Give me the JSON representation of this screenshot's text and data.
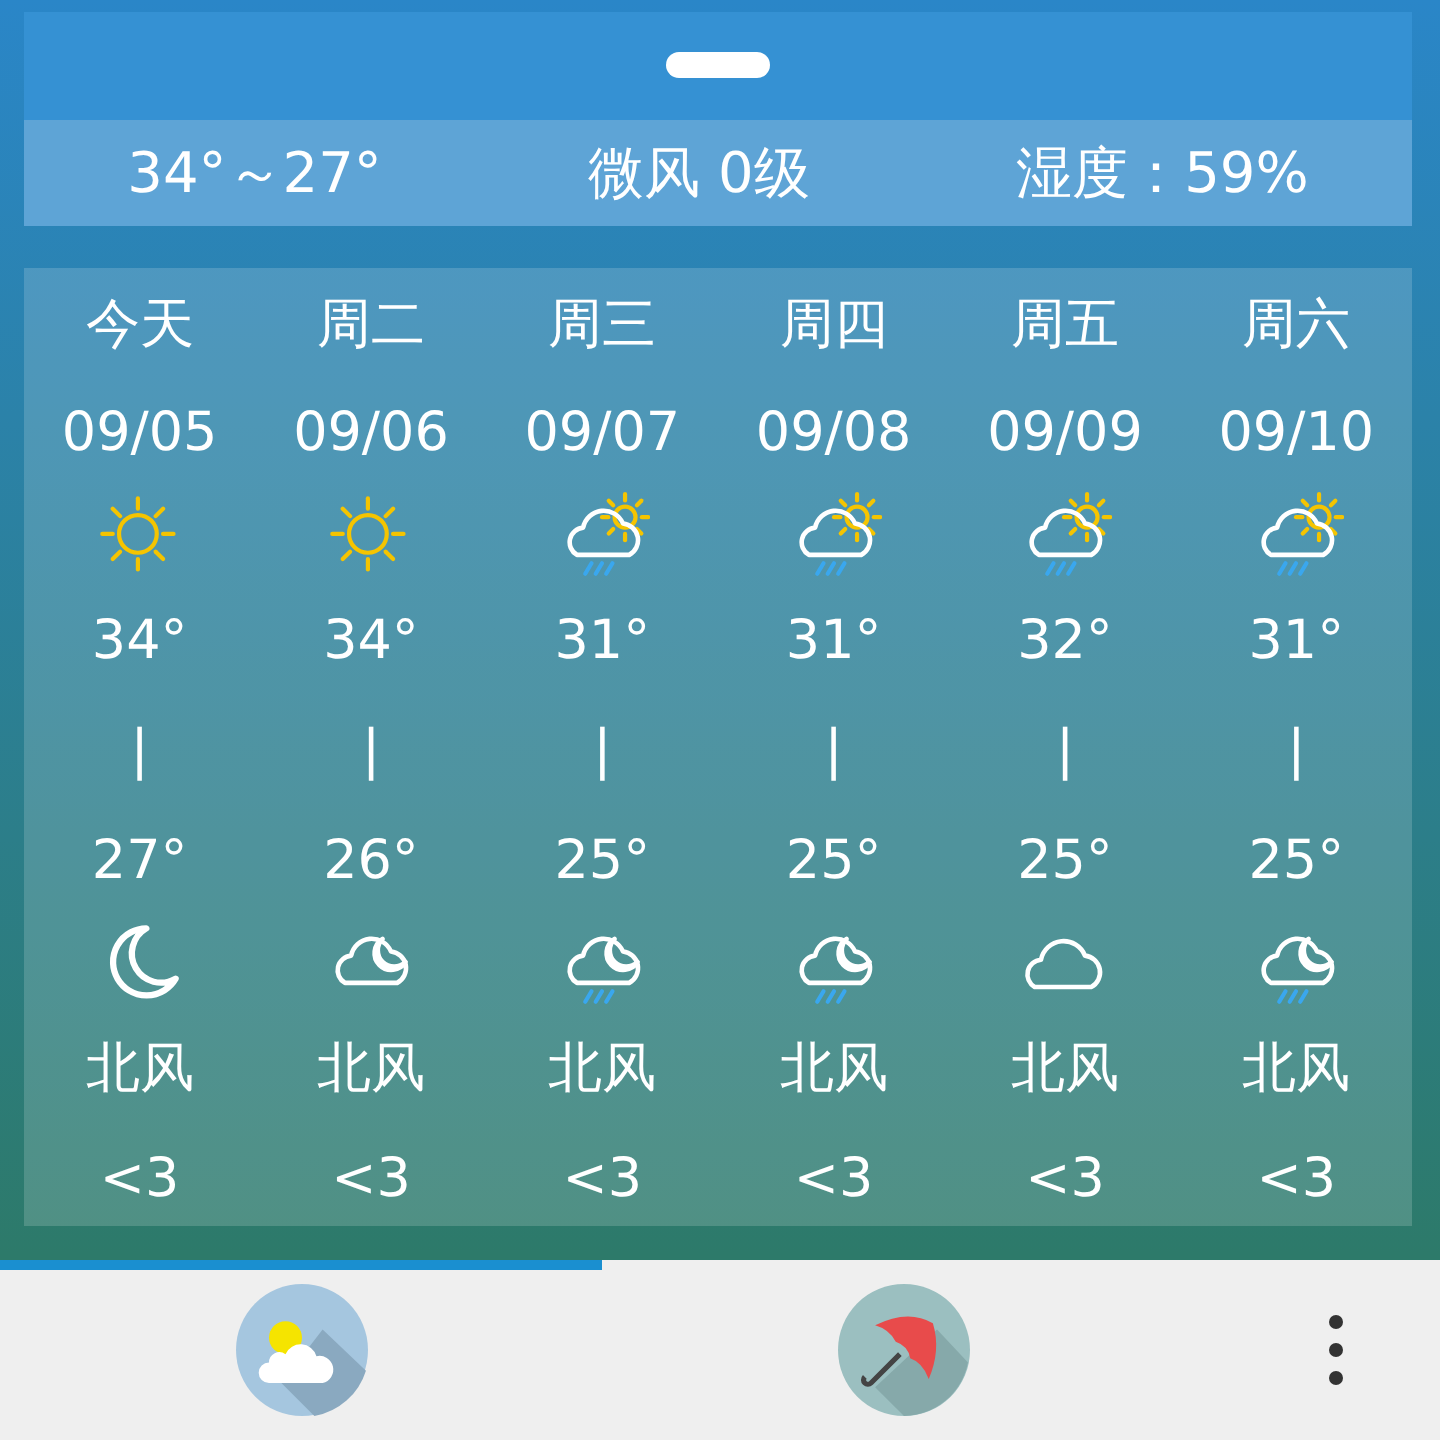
{
  "summary": {
    "temperature": "34°～27°",
    "wind": "微风 0级",
    "humidity": "湿度：59%"
  },
  "forecast": [
    {
      "day": "今天",
      "date": "09/05",
      "day_icon": {
        "kind": "sun"
      },
      "high": "34°",
      "separator": "|",
      "low": "27°",
      "night_icon": {
        "kind": "moon"
      },
      "wind": "北风",
      "wind_level": "<3"
    },
    {
      "day": "周二",
      "date": "09/06",
      "day_icon": {
        "kind": "sun"
      },
      "high": "34°",
      "separator": "|",
      "low": "26°",
      "night_icon": {
        "kind": "cloud-moon"
      },
      "wind": "北风",
      "wind_level": "<3"
    },
    {
      "day": "周三",
      "date": "09/07",
      "day_icon": {
        "kind": "cloud-sun-rain"
      },
      "high": "31°",
      "separator": "|",
      "low": "25°",
      "night_icon": {
        "kind": "cloud-moon-rain"
      },
      "wind": "北风",
      "wind_level": "<3"
    },
    {
      "day": "周四",
      "date": "09/08",
      "day_icon": {
        "kind": "cloud-sun-rain"
      },
      "high": "31°",
      "separator": "|",
      "low": "25°",
      "night_icon": {
        "kind": "cloud-moon-rain"
      },
      "wind": "北风",
      "wind_level": "<3"
    },
    {
      "day": "周五",
      "date": "09/09",
      "day_icon": {
        "kind": "cloud-sun-rain"
      },
      "high": "32°",
      "separator": "|",
      "low": "25°",
      "night_icon": {
        "kind": "cloud"
      },
      "wind": "北风",
      "wind_level": "<3"
    },
    {
      "day": "周六",
      "date": "09/10",
      "day_icon": {
        "kind": "cloud-sun-rain"
      },
      "high": "31°",
      "separator": "|",
      "low": "25°",
      "night_icon": {
        "kind": "cloud-moon-rain"
      },
      "wind": "北风",
      "wind_level": "<3"
    }
  ],
  "tabs": [
    {
      "kind": "weather",
      "selected": true
    },
    {
      "kind": "umbrella",
      "selected": false
    }
  ]
}
